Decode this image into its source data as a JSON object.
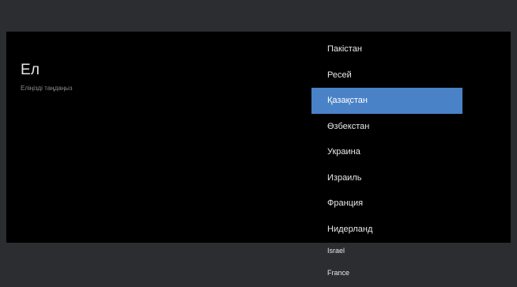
{
  "settings": {
    "title": "Ел",
    "subtitle": "Еліңізді таңдаңыз"
  },
  "country_list": {
    "selected_index": 2,
    "items": [
      {
        "label": "Пакістан"
      },
      {
        "label": "Ресей"
      },
      {
        "label": "Қазақстан"
      },
      {
        "label": "Өзбекстан"
      },
      {
        "label": "Украина"
      },
      {
        "label": "Израиль"
      },
      {
        "label": "Франция"
      },
      {
        "label": "Нидерланд"
      }
    ]
  },
  "background_list": {
    "items": [
      {
        "label": "Israel"
      },
      {
        "label": "France"
      }
    ]
  },
  "colors": {
    "selection": "#4a82c8",
    "panel_background": "#000000",
    "screen_background": "#2c2d30"
  }
}
